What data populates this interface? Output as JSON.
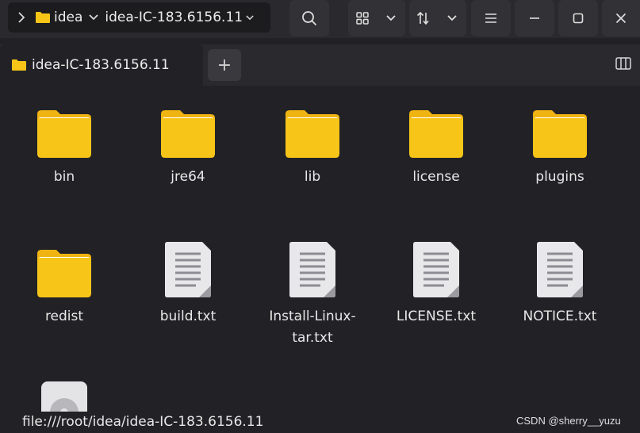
{
  "headerbar": {
    "path_items": [
      {
        "label": "idea"
      },
      {
        "label": "idea-IC-183.6156.11"
      }
    ]
  },
  "tab": {
    "label": "idea-IC-183.6156.11",
    "new_tab_label": "+"
  },
  "files": [
    {
      "name": "bin",
      "type": "folder"
    },
    {
      "name": "jre64",
      "type": "folder"
    },
    {
      "name": "lib",
      "type": "folder"
    },
    {
      "name": "license",
      "type": "folder"
    },
    {
      "name": "plugins",
      "type": "folder"
    },
    {
      "name": "redist",
      "type": "folder"
    },
    {
      "name": "build.txt",
      "type": "text"
    },
    {
      "name": "Install-Linux-tar.txt",
      "type": "text"
    },
    {
      "name": "LICENSE.txt",
      "type": "text"
    },
    {
      "name": "NOTICE.txt",
      "type": "text"
    },
    {
      "name": "",
      "type": "disc"
    }
  ],
  "status": {
    "location": "file:///root/idea/idea-IC-183.6156.11"
  },
  "watermark": "CSDN @sherry__yuzu",
  "colors": {
    "folder_body": "#f7c518",
    "folder_back": "#f0b412",
    "background": "#222226",
    "headerbar": "#2a2a2e"
  }
}
